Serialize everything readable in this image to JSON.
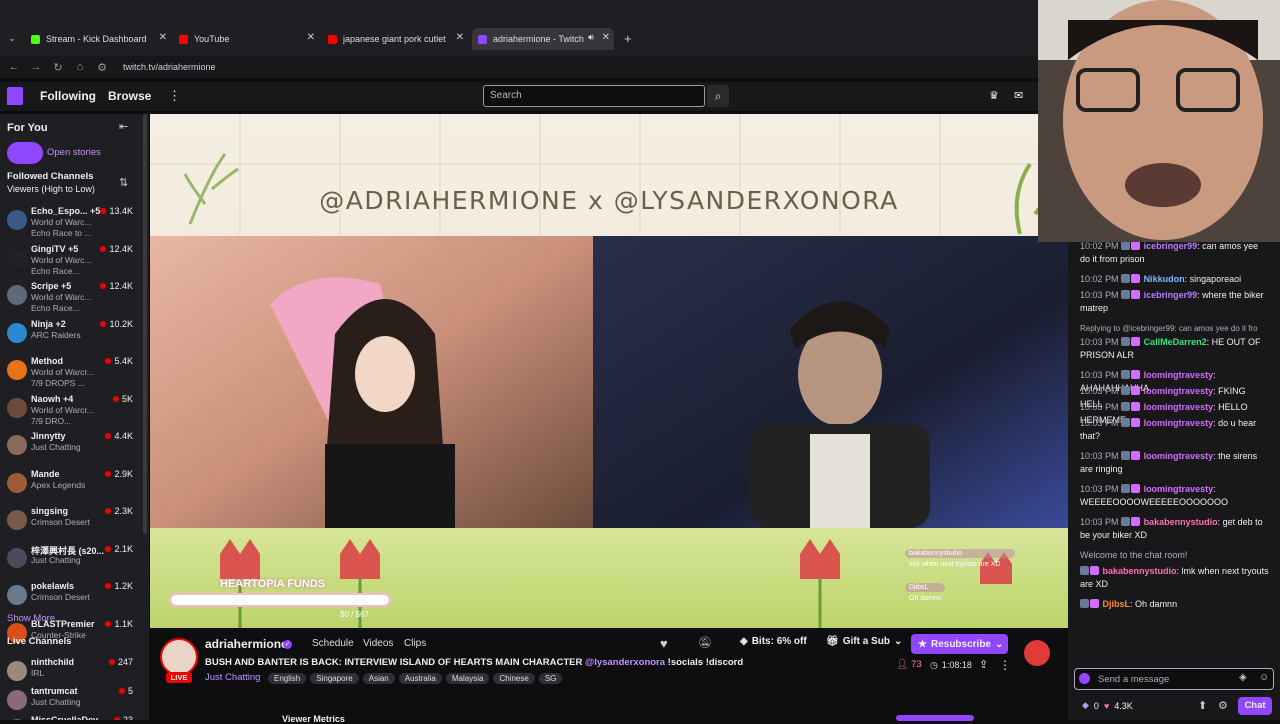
{
  "browser": {
    "tabs": [
      {
        "title": "Stream - Kick Dashboard",
        "favicon_color": "#53fc18"
      },
      {
        "title": "YouTube",
        "favicon_color": "#ff0000"
      },
      {
        "title": "japanese giant pork cutlet sand",
        "favicon_color": "#ff0000"
      },
      {
        "title": "adriahermione - Twitch",
        "favicon_color": "#9147ff"
      }
    ],
    "url": "twitch.tv/adriahermione"
  },
  "topnav": {
    "following": "Following",
    "browse": "Browse",
    "search_placeholder": "Search"
  },
  "sidebar": {
    "for_you": "For You",
    "open_stories": "Open stories",
    "followed_heading": "Followed Channels",
    "sort_label": "Viewers (High to Low)",
    "followed": [
      {
        "name": "Echo_Espo... +5",
        "l1": "World of Warc...",
        "l2": "Echo Race to ...",
        "viewers": "13.4K",
        "color": "#3a5a8a"
      },
      {
        "name": "GingiTV +5",
        "l1": "World of Warc...",
        "l2": "Echo Race...",
        "viewers": "12.4K",
        "color": "#222"
      },
      {
        "name": "Scripe +5",
        "l1": "World of Warc...",
        "l2": "Echo Race...",
        "viewers": "12.4K",
        "color": "#5a6a7a"
      },
      {
        "name": "Ninja +2",
        "l1": "ARC Raiders",
        "l2": "",
        "viewers": "10.2K",
        "color": "#2a8ad1"
      },
      {
        "name": "Method",
        "l1": "World of Warcr...",
        "l2": "7/9 DROPS ...",
        "viewers": "5.4K",
        "color": "#e8741a"
      },
      {
        "name": "Naowh +4",
        "l1": "World of Warcr...",
        "l2": "7/9 DRO...",
        "viewers": "5K",
        "color": "#6d4a3a"
      },
      {
        "name": "Jinnytty",
        "l1": "Just Chatting",
        "l2": "",
        "viewers": "4.4K",
        "color": "#8a6a5a"
      },
      {
        "name": "Mande",
        "l1": "Apex Legends",
        "l2": "",
        "viewers": "2.9K",
        "color": "#a05a3a"
      },
      {
        "name": "singsing",
        "l1": "Crimson Desert",
        "l2": "",
        "viewers": "2.3K",
        "color": "#7a5a4a"
      },
      {
        "name": "梓澤興村長 (s20...",
        "l1": "Just Chatting",
        "l2": "",
        "viewers": "2.1K",
        "color": "#4a4a5a"
      },
      {
        "name": "pokelawls",
        "l1": "Crimson Desert",
        "l2": "",
        "viewers": "1.2K",
        "color": "#6a7a8a"
      },
      {
        "name": "BLASTPremier",
        "l1": "Counter-Strike",
        "l2": "",
        "viewers": "1.1K",
        "color": "#d94f1a"
      }
    ],
    "show_more": "Show More",
    "live_heading": "Live Channels",
    "live": [
      {
        "name": "ninthchild",
        "l1": "IRL",
        "viewers": "247",
        "color": "#9a8a7a"
      },
      {
        "name": "tantrumcat",
        "l1": "Just Chatting",
        "viewers": "5",
        "color": "#8a6a7a"
      },
      {
        "name": "MissCruellaDev...",
        "l1": "",
        "viewers": "23",
        "color": "#7a6a5a"
      }
    ]
  },
  "stream": {
    "banner": "@ADRIAHERMIONE x @LYSANDERXONORA",
    "funds_label": "HEARTOPIA FUNDS",
    "funds_value": "$0 / $67",
    "overlay_chat": [
      {
        "user": "bakabennystudio",
        "text": "lmk when next tryouts are XD"
      },
      {
        "user": "DjibsL",
        "text": "Oh damnn"
      }
    ],
    "progress": 0.0
  },
  "channel": {
    "name": "adriahermione",
    "live": "LIVE",
    "tabs": [
      "Schedule",
      "Videos",
      "Clips"
    ],
    "bits": "Bits: 6% off",
    "gift": "Gift a Sub",
    "resub": "Resubscribe",
    "title_prefix": "BUSH AND BANTER IS BACK: INTERVIEW ISLAND OF HEARTS MAIN CHARACTER",
    "title_mention": "@lysanderxonora",
    "title_suffix": "!socials !discord",
    "category": "Just Chatting",
    "tags": [
      "English",
      "Singapore",
      "Asian",
      "Australia",
      "Malaysia",
      "Chinese",
      "SG"
    ],
    "viewers": "73",
    "uptime": "1:08:18",
    "viewer_metrics": "Viewer Metrics"
  },
  "chat": {
    "messages": [
      {
        "time": "10:02 PM",
        "user": "icebringer99",
        "color": "#b57cff",
        "text": "can amos yee do it from prison"
      },
      {
        "time": "10:02 PM",
        "user": "Nikkudon",
        "color": "#7ab8ff",
        "text": "singaporeaoi"
      },
      {
        "time": "10:03 PM",
        "user": "icebringer99",
        "color": "#b57cff",
        "text": "where the biker matrep"
      },
      {
        "reply": "Replying to @icebringer99: can amos yee do it fro"
      },
      {
        "time": "10:03 PM",
        "user": "CallMeDarren2",
        "color": "#2ee87a",
        "text": "HE OUT OF PRISON ALR"
      },
      {
        "time": "10:03 PM",
        "user": "loomingtravesty",
        "color": "#d46cff",
        "text": "AHAHAHHAHHA"
      },
      {
        "time": "10:03 PM",
        "user": "loomingtravesty",
        "color": "#d46cff",
        "text": "FKING HELL"
      },
      {
        "time": "10:03 PM",
        "user": "loomingtravesty",
        "color": "#d46cff",
        "text": "HELLO HERMEME"
      },
      {
        "time": "10:03 PM",
        "user": "loomingtravesty",
        "color": "#d46cff",
        "text": "do u hear that?"
      },
      {
        "time": "10:03 PM",
        "user": "loomingtravesty",
        "color": "#d46cff",
        "text": "the sirens are ringing"
      },
      {
        "time": "10:03 PM",
        "user": "loomingtravesty",
        "color": "#d46cff",
        "text": "WEEEEOOOOWEEEEEOOOOOOO"
      },
      {
        "time": "10:03 PM",
        "user": "bakabennystudio",
        "color": "#ff6fb5",
        "text": "get deb to be your biker XD"
      },
      {
        "system": "Welcome to the chat room!"
      },
      {
        "time": "",
        "user": "bakabennystudio",
        "color": "#ff6fb5",
        "text": "lmk when next tryouts are XD"
      },
      {
        "time": "",
        "user": "DjibsL",
        "color": "#ff8a3a",
        "text": "Oh damnn"
      }
    ],
    "input_placeholder": "Send a message",
    "points": "0",
    "points2": "4.3K",
    "chat_button": "Chat"
  }
}
